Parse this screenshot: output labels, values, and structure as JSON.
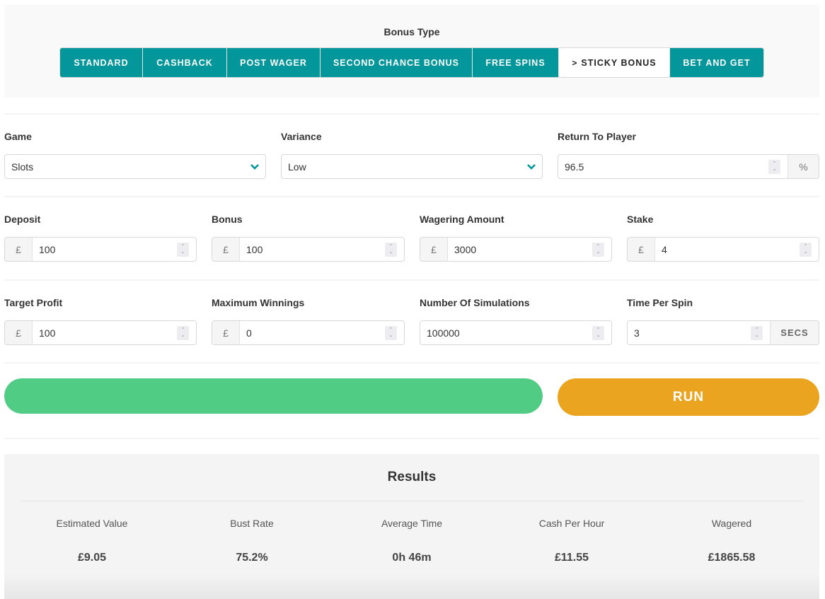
{
  "bonus_type": {
    "title": "Bonus Type",
    "tabs": [
      {
        "label": "STANDARD",
        "active": false
      },
      {
        "label": "CASHBACK",
        "active": false
      },
      {
        "label": "POST WAGER",
        "active": false
      },
      {
        "label": "SECOND CHANCE BONUS",
        "active": false
      },
      {
        "label": "FREE SPINS",
        "active": false
      },
      {
        "label": "STICKY BONUS",
        "active": true
      },
      {
        "label": "BET AND GET",
        "active": false
      }
    ],
    "active_indicator": ">"
  },
  "fields": {
    "game": {
      "label": "Game",
      "value": "Slots",
      "icon": "chevron-down-icon"
    },
    "variance": {
      "label": "Variance",
      "value": "Low",
      "icon": "chevron-down-icon"
    },
    "rtp": {
      "label": "Return To Player",
      "value": "96.5",
      "suffix": "%"
    },
    "deposit": {
      "label": "Deposit",
      "prefix": "£",
      "value": "100"
    },
    "bonus": {
      "label": "Bonus",
      "prefix": "£",
      "value": "100"
    },
    "wagering": {
      "label": "Wagering Amount",
      "prefix": "£",
      "value": "3000"
    },
    "stake": {
      "label": "Stake",
      "prefix": "£",
      "value": "4"
    },
    "target_profit": {
      "label": "Target Profit",
      "prefix": "£",
      "value": "100"
    },
    "max_winnings": {
      "label": "Maximum Winnings",
      "prefix": "£",
      "value": "0"
    },
    "simulations": {
      "label": "Number Of Simulations",
      "value": "100000"
    },
    "time_per_spin": {
      "label": "Time Per Spin",
      "value": "3",
      "suffix": "SECS"
    }
  },
  "progress": {
    "percent": 100,
    "color": "#50cc84"
  },
  "run_button": {
    "label": "RUN",
    "color": "#eaa41f"
  },
  "results": {
    "title": "Results",
    "items": [
      {
        "label": "Estimated Value",
        "value": "£9.05"
      },
      {
        "label": "Bust Rate",
        "value": "75.2%"
      },
      {
        "label": "Average Time",
        "value": "0h 46m"
      },
      {
        "label": "Cash Per Hour",
        "value": "£11.55"
      },
      {
        "label": "Wagered",
        "value": "£1865.58"
      }
    ]
  },
  "colors": {
    "accent": "#03979b",
    "tab_active_bg": "#ffffff"
  }
}
